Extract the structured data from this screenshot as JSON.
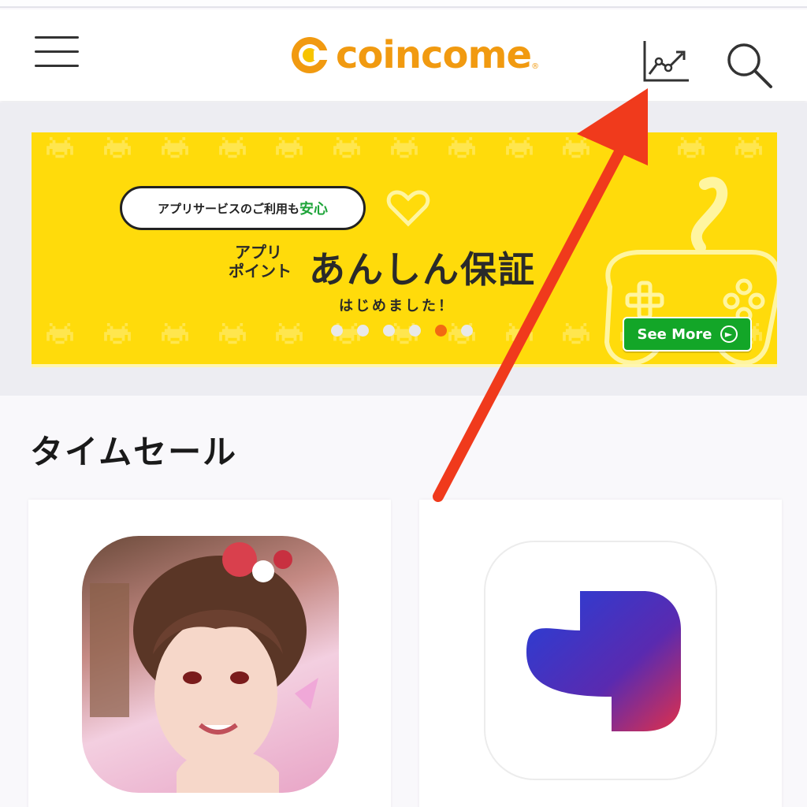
{
  "header": {
    "logo_text": "coincome",
    "logo_mark": "®",
    "menu_icon": "hamburger-menu-icon",
    "chart_icon": "line-chart-icon",
    "search_icon": "search-icon",
    "brand_color": "#f19a10"
  },
  "banner": {
    "bubble_text": "アプリサービスのご利用も",
    "bubble_accent": "安心",
    "label_line1": "アプリ",
    "label_line2": "ポイント",
    "title": "あんしん保証",
    "subtitle": "はじめました！",
    "see_more_label": "See More",
    "slide_count": 6,
    "active_slide": 5,
    "background_color": "#ffdb0b"
  },
  "section": {
    "title": "タイムセール"
  },
  "cards": [
    {
      "icon": "game-character-app-icon"
    },
    {
      "icon": "blue-gradient-p-app-icon"
    }
  ],
  "annotation": {
    "arrow_color": "#f03a1c"
  }
}
